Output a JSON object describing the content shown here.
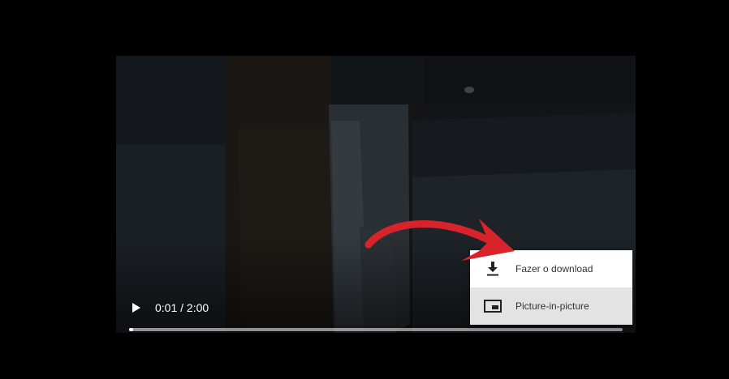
{
  "player": {
    "play_icon": "play-icon",
    "time": "0:01 / 2:00",
    "progress": 0.0083
  },
  "menu": {
    "items": [
      {
        "label": "Fazer o download",
        "icon": "download-icon",
        "highlighted": false
      },
      {
        "label": "Picture-in-picture",
        "icon": "picture-in-picture-icon",
        "highlighted": true
      }
    ]
  },
  "annotation": {
    "icon": "curved-arrow-icon",
    "color": "#d8232a"
  }
}
